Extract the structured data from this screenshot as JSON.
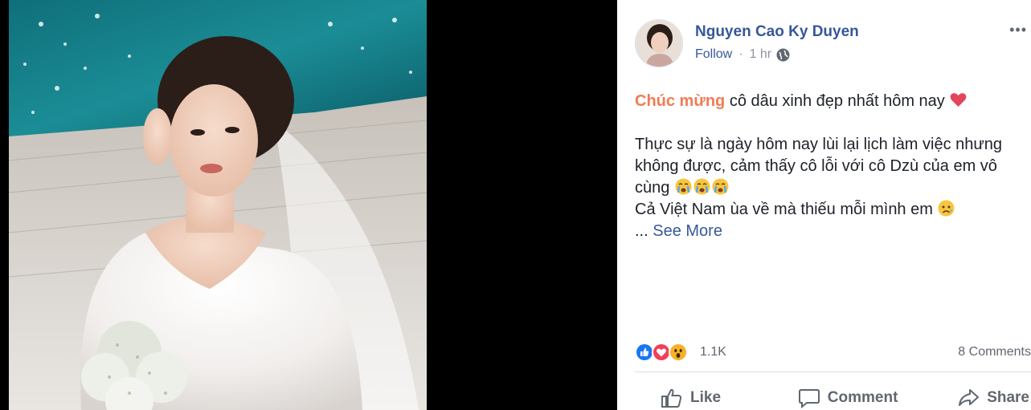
{
  "post": {
    "author": "Nguyen Cao Ky Duyen",
    "follow_label": "Follow",
    "separator": "·",
    "time": "1 hr",
    "more_label": "•••",
    "highlight": "Chúc mừng",
    "line1_rest": " cô dâu xinh đẹp nhất hôm nay",
    "para2_text": "Thực sự là ngày hôm nay lùi lại lịch làm việc nhưng không được, cảm thấy cô lỗi với cô Dzù của em vô cùng",
    "line_last": "Cả Việt Nam ùa về mà thiếu mỗi mình em",
    "ellipsis": "...",
    "see_more": "See More"
  },
  "stats": {
    "reaction_count": "1.1K",
    "comments": "8 Comments"
  },
  "actions": {
    "like": "Like",
    "comment": "Comment",
    "share": "Share"
  },
  "colors": {
    "link": "#365899",
    "highlight": "#f07c54",
    "like_blue": "#1877f2",
    "love_red": "#f33e58",
    "wow_yellow": "#f7b125"
  },
  "icons": [
    "avatar",
    "globe-icon",
    "heart-emoji",
    "crying-emoji",
    "sad-emoji",
    "like-reaction-icon",
    "love-reaction-icon",
    "wow-reaction-icon",
    "like-icon",
    "comment-icon",
    "share-icon"
  ]
}
